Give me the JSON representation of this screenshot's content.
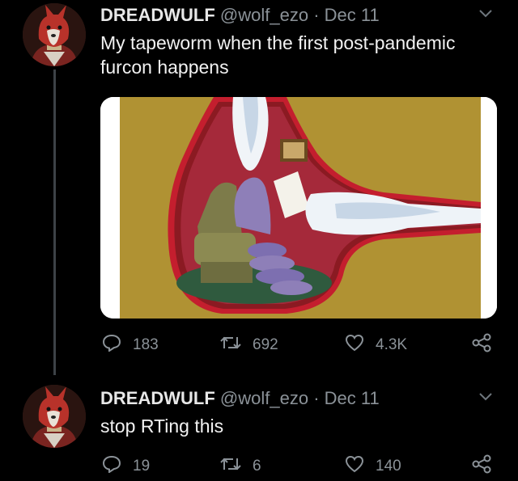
{
  "tweets": [
    {
      "author": "DREADWULF",
      "handle": "@wolf_ezo",
      "separator": "·",
      "date": "Dec 11",
      "text": "My tapeworm when the first post-pandemic furcon happens",
      "replies": "183",
      "retweets": "692",
      "likes": "4.3K"
    },
    {
      "author": "DREADWULF",
      "handle": "@wolf_ezo",
      "separator": "·",
      "date": "Dec 11",
      "text": "stop RTing this",
      "replies": "19",
      "retweets": "6",
      "likes": "140"
    }
  ],
  "icons": {
    "reply": "reply-icon",
    "retweet": "retweet-icon",
    "like": "heart-icon",
    "share": "share-icon",
    "more": "chevron-down-icon"
  },
  "colors": {
    "background": "#000000",
    "muted_text": "#8b9298",
    "thread_line": "#3d4247"
  }
}
